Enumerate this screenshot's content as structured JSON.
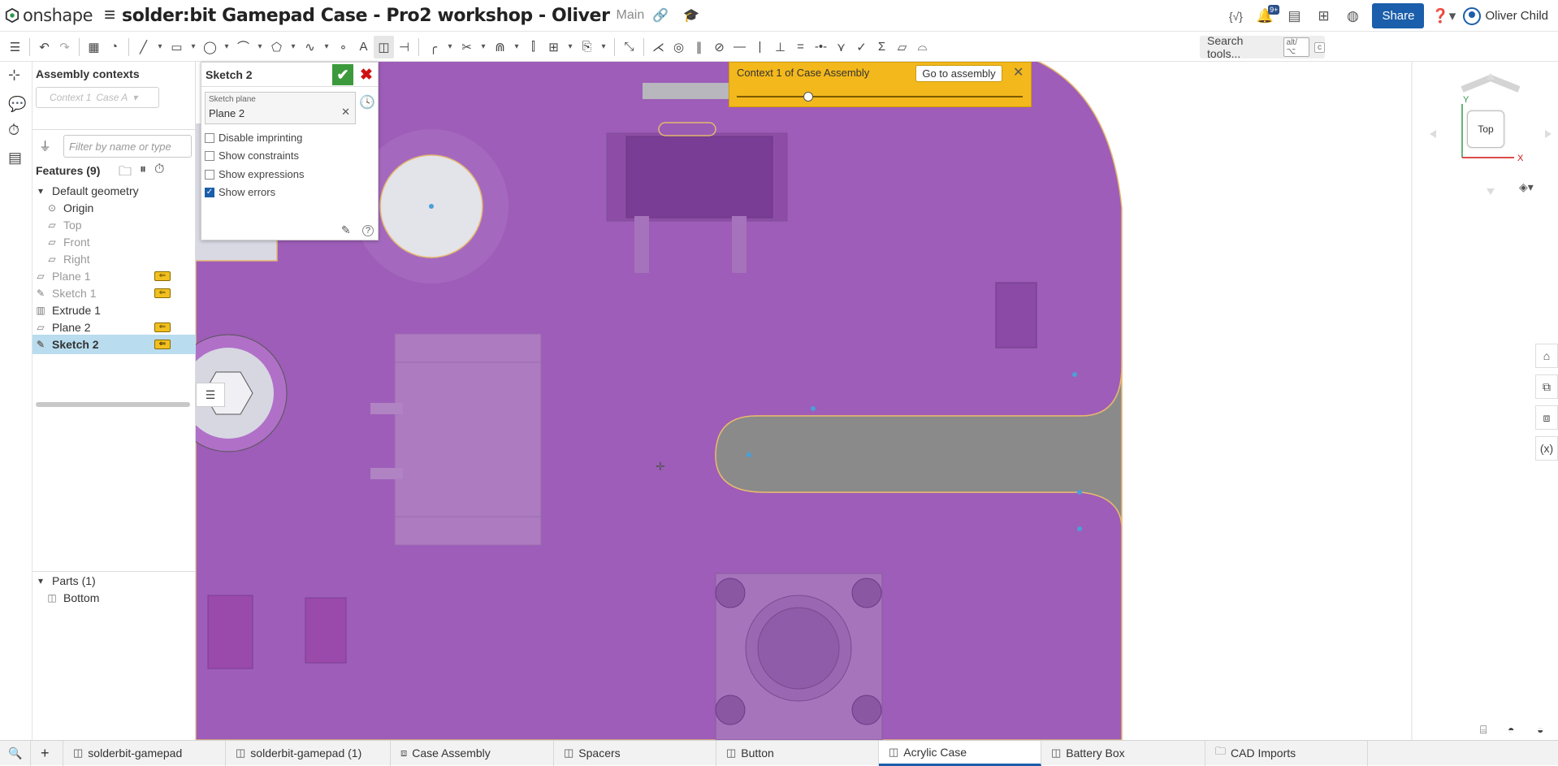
{
  "app": {
    "logo_text": "onshape",
    "doc_title": "solder:bit Gamepad Case - Pro2 workshop - Oliver",
    "branch": "Main"
  },
  "topbar": {
    "notification_count": "9+",
    "share_label": "Share",
    "user_name": "Oliver Child"
  },
  "toolbar": {
    "search_label": "Search tools...",
    "search_shortcut_1": "alt/⌥",
    "search_shortcut_2": "c"
  },
  "feature_panel": {
    "assembly_contexts_title": "Assembly contexts",
    "context_select": "Context 1",
    "context_select_2": "Case A",
    "filter_placeholder": "Filter by name or type",
    "features_title": "Features (9)",
    "items": [
      {
        "label": "Default geometry",
        "icon": "caret-icon"
      },
      {
        "label": "Origin",
        "icon": "origin-icon"
      },
      {
        "label": "Top",
        "icon": "plane-icon"
      },
      {
        "label": "Front",
        "icon": "plane-icon"
      },
      {
        "label": "Right",
        "icon": "plane-icon"
      },
      {
        "label": "Plane 1",
        "icon": "plane-icon"
      },
      {
        "label": "Sketch 1",
        "icon": "sketch-icon"
      },
      {
        "label": "Extrude 1",
        "icon": "extrude-icon"
      },
      {
        "label": "Plane 2",
        "icon": "plane-icon"
      },
      {
        "label": "Sketch 2",
        "icon": "sketch-icon"
      }
    ],
    "parts_title": "Parts (1)",
    "parts": [
      {
        "label": "Bottom"
      }
    ]
  },
  "sketch_dialog": {
    "title": "Sketch 2",
    "plane_label": "Sketch plane",
    "plane_value": "Plane 2",
    "options": [
      {
        "label": "Disable imprinting",
        "checked": false
      },
      {
        "label": "Show constraints",
        "checked": false
      },
      {
        "label": "Show expressions",
        "checked": false
      },
      {
        "label": "Show errors",
        "checked": true
      }
    ]
  },
  "context_banner": {
    "text": "Context 1 of Case Assembly",
    "button": "Go to assembly",
    "slider_position": 0.25
  },
  "viewcube": {
    "face_label": "Top",
    "x_axis": "X",
    "y_axis": "Y"
  },
  "colors": {
    "accent": "#1b5eab",
    "part_purple": "#9d5db8",
    "bright_purple": "#c04ad8",
    "banner": "#f3b81b",
    "confirm_green": "#3c9a3c"
  },
  "tabs": [
    {
      "label": "solderbit-gamepad",
      "icon": "partstudio-icon"
    },
    {
      "label": "solderbit-gamepad (1)",
      "icon": "partstudio-icon"
    },
    {
      "label": "Case Assembly",
      "icon": "assembly-icon"
    },
    {
      "label": "Spacers",
      "icon": "partstudio-icon"
    },
    {
      "label": "Button",
      "icon": "partstudio-icon"
    },
    {
      "label": "Acrylic Case",
      "icon": "partstudio-icon",
      "active": true
    },
    {
      "label": "Battery Box",
      "icon": "partstudio-icon"
    },
    {
      "label": "CAD Imports",
      "icon": "folder-icon"
    }
  ]
}
